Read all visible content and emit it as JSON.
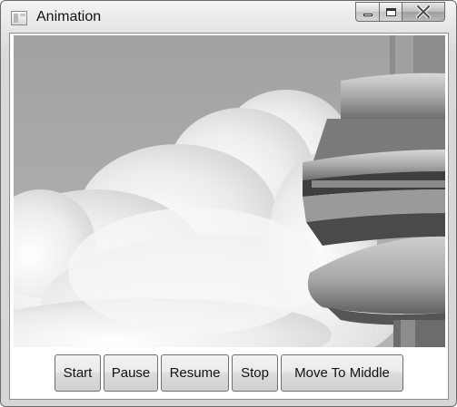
{
  "window": {
    "title": "Animation"
  },
  "caption": {
    "minimize_icon": "minimize-icon",
    "maximize_icon": "maximize-icon",
    "close_icon": "close-icon"
  },
  "image": {
    "subject": "photo"
  },
  "buttons": {
    "start": "Start",
    "pause": "Pause",
    "resume": "Resume",
    "stop": "Stop",
    "move_to_middle": "Move To Middle"
  },
  "colors": {
    "window_border": "#6b6b6b",
    "client_background": "#ffffff",
    "sky": "#9e9e9e"
  }
}
